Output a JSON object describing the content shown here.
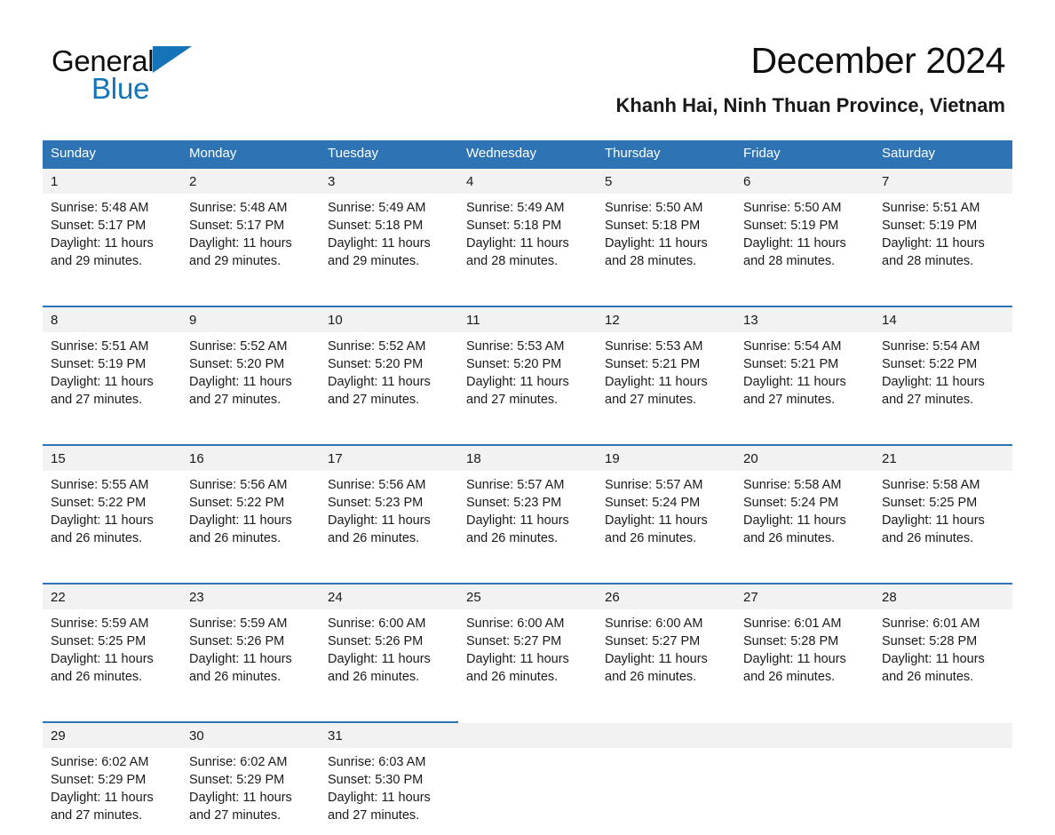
{
  "brand": {
    "name_part1": "General",
    "name_part2": "Blue",
    "logo_icon": "triangle-logo-icon",
    "accent_color": "#1574b7"
  },
  "header": {
    "title": "December 2024",
    "location": "Khanh Hai, Ninh Thuan Province, Vietnam"
  },
  "calendar": {
    "header_color": "#2e74b5",
    "daynum_band_color": "#f2f2f2",
    "weekday_headers": [
      "Sunday",
      "Monday",
      "Tuesday",
      "Wednesday",
      "Thursday",
      "Friday",
      "Saturday"
    ],
    "weeks": [
      [
        {
          "day": "1",
          "sunrise": "Sunrise: 5:48 AM",
          "sunset": "Sunset: 5:17 PM",
          "daylight": "Daylight: 11 hours and 29 minutes."
        },
        {
          "day": "2",
          "sunrise": "Sunrise: 5:48 AM",
          "sunset": "Sunset: 5:17 PM",
          "daylight": "Daylight: 11 hours and 29 minutes."
        },
        {
          "day": "3",
          "sunrise": "Sunrise: 5:49 AM",
          "sunset": "Sunset: 5:18 PM",
          "daylight": "Daylight: 11 hours and 29 minutes."
        },
        {
          "day": "4",
          "sunrise": "Sunrise: 5:49 AM",
          "sunset": "Sunset: 5:18 PM",
          "daylight": "Daylight: 11 hours and 28 minutes."
        },
        {
          "day": "5",
          "sunrise": "Sunrise: 5:50 AM",
          "sunset": "Sunset: 5:18 PM",
          "daylight": "Daylight: 11 hours and 28 minutes."
        },
        {
          "day": "6",
          "sunrise": "Sunrise: 5:50 AM",
          "sunset": "Sunset: 5:19 PM",
          "daylight": "Daylight: 11 hours and 28 minutes."
        },
        {
          "day": "7",
          "sunrise": "Sunrise: 5:51 AM",
          "sunset": "Sunset: 5:19 PM",
          "daylight": "Daylight: 11 hours and 28 minutes."
        }
      ],
      [
        {
          "day": "8",
          "sunrise": "Sunrise: 5:51 AM",
          "sunset": "Sunset: 5:19 PM",
          "daylight": "Daylight: 11 hours and 27 minutes."
        },
        {
          "day": "9",
          "sunrise": "Sunrise: 5:52 AM",
          "sunset": "Sunset: 5:20 PM",
          "daylight": "Daylight: 11 hours and 27 minutes."
        },
        {
          "day": "10",
          "sunrise": "Sunrise: 5:52 AM",
          "sunset": "Sunset: 5:20 PM",
          "daylight": "Daylight: 11 hours and 27 minutes."
        },
        {
          "day": "11",
          "sunrise": "Sunrise: 5:53 AM",
          "sunset": "Sunset: 5:20 PM",
          "daylight": "Daylight: 11 hours and 27 minutes."
        },
        {
          "day": "12",
          "sunrise": "Sunrise: 5:53 AM",
          "sunset": "Sunset: 5:21 PM",
          "daylight": "Daylight: 11 hours and 27 minutes."
        },
        {
          "day": "13",
          "sunrise": "Sunrise: 5:54 AM",
          "sunset": "Sunset: 5:21 PM",
          "daylight": "Daylight: 11 hours and 27 minutes."
        },
        {
          "day": "14",
          "sunrise": "Sunrise: 5:54 AM",
          "sunset": "Sunset: 5:22 PM",
          "daylight": "Daylight: 11 hours and 27 minutes."
        }
      ],
      [
        {
          "day": "15",
          "sunrise": "Sunrise: 5:55 AM",
          "sunset": "Sunset: 5:22 PM",
          "daylight": "Daylight: 11 hours and 26 minutes."
        },
        {
          "day": "16",
          "sunrise": "Sunrise: 5:56 AM",
          "sunset": "Sunset: 5:22 PM",
          "daylight": "Daylight: 11 hours and 26 minutes."
        },
        {
          "day": "17",
          "sunrise": "Sunrise: 5:56 AM",
          "sunset": "Sunset: 5:23 PM",
          "daylight": "Daylight: 11 hours and 26 minutes."
        },
        {
          "day": "18",
          "sunrise": "Sunrise: 5:57 AM",
          "sunset": "Sunset: 5:23 PM",
          "daylight": "Daylight: 11 hours and 26 minutes."
        },
        {
          "day": "19",
          "sunrise": "Sunrise: 5:57 AM",
          "sunset": "Sunset: 5:24 PM",
          "daylight": "Daylight: 11 hours and 26 minutes."
        },
        {
          "day": "20",
          "sunrise": "Sunrise: 5:58 AM",
          "sunset": "Sunset: 5:24 PM",
          "daylight": "Daylight: 11 hours and 26 minutes."
        },
        {
          "day": "21",
          "sunrise": "Sunrise: 5:58 AM",
          "sunset": "Sunset: 5:25 PM",
          "daylight": "Daylight: 11 hours and 26 minutes."
        }
      ],
      [
        {
          "day": "22",
          "sunrise": "Sunrise: 5:59 AM",
          "sunset": "Sunset: 5:25 PM",
          "daylight": "Daylight: 11 hours and 26 minutes."
        },
        {
          "day": "23",
          "sunrise": "Sunrise: 5:59 AM",
          "sunset": "Sunset: 5:26 PM",
          "daylight": "Daylight: 11 hours and 26 minutes."
        },
        {
          "day": "24",
          "sunrise": "Sunrise: 6:00 AM",
          "sunset": "Sunset: 5:26 PM",
          "daylight": "Daylight: 11 hours and 26 minutes."
        },
        {
          "day": "25",
          "sunrise": "Sunrise: 6:00 AM",
          "sunset": "Sunset: 5:27 PM",
          "daylight": "Daylight: 11 hours and 26 minutes."
        },
        {
          "day": "26",
          "sunrise": "Sunrise: 6:00 AM",
          "sunset": "Sunset: 5:27 PM",
          "daylight": "Daylight: 11 hours and 26 minutes."
        },
        {
          "day": "27",
          "sunrise": "Sunrise: 6:01 AM",
          "sunset": "Sunset: 5:28 PM",
          "daylight": "Daylight: 11 hours and 26 minutes."
        },
        {
          "day": "28",
          "sunrise": "Sunrise: 6:01 AM",
          "sunset": "Sunset: 5:28 PM",
          "daylight": "Daylight: 11 hours and 26 minutes."
        }
      ],
      [
        {
          "day": "29",
          "sunrise": "Sunrise: 6:02 AM",
          "sunset": "Sunset: 5:29 PM",
          "daylight": "Daylight: 11 hours and 27 minutes."
        },
        {
          "day": "30",
          "sunrise": "Sunrise: 6:02 AM",
          "sunset": "Sunset: 5:29 PM",
          "daylight": "Daylight: 11 hours and 27 minutes."
        },
        {
          "day": "31",
          "sunrise": "Sunrise: 6:03 AM",
          "sunset": "Sunset: 5:30 PM",
          "daylight": "Daylight: 11 hours and 27 minutes."
        },
        {
          "day": "",
          "sunrise": "",
          "sunset": "",
          "daylight": ""
        },
        {
          "day": "",
          "sunrise": "",
          "sunset": "",
          "daylight": ""
        },
        {
          "day": "",
          "sunrise": "",
          "sunset": "",
          "daylight": ""
        },
        {
          "day": "",
          "sunrise": "",
          "sunset": "",
          "daylight": ""
        }
      ]
    ]
  }
}
